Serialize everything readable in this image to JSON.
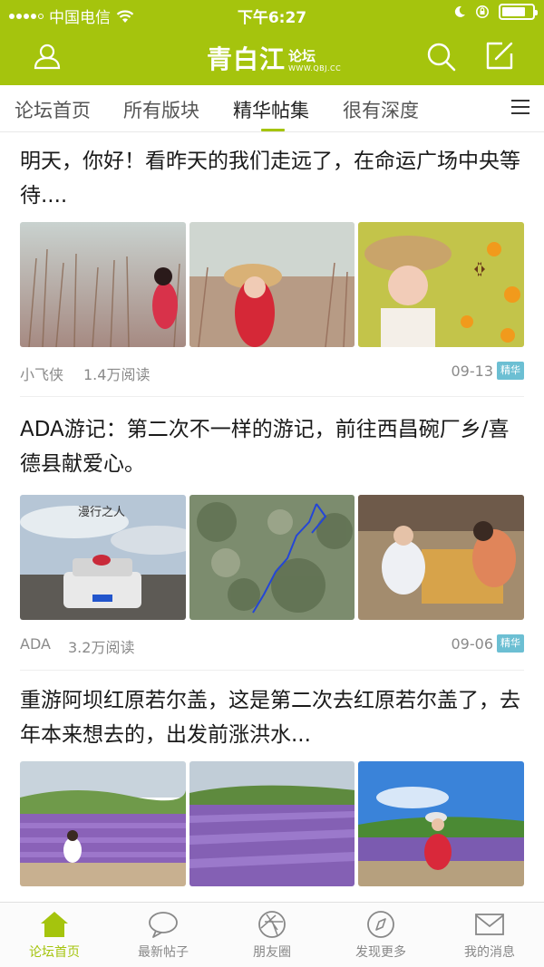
{
  "status_bar": {
    "carrier": "中国电信",
    "time": "下午6:27",
    "battery_level": 0.78
  },
  "header": {
    "logo_main": "青白江",
    "logo_sub": "论坛",
    "logo_url": "WWW.QBJ.CC",
    "icons": [
      "user-icon",
      "search-icon",
      "compose-icon"
    ]
  },
  "tabs": {
    "items": [
      {
        "label": "论坛首页"
      },
      {
        "label": "所有版块"
      },
      {
        "label": "精华帖集"
      },
      {
        "label": "很有深度"
      }
    ],
    "active_index": 2
  },
  "posts": [
    {
      "title": "明天，你好！看昨天的我们走远了，在命运广场中央等待....",
      "author": "小飞侠",
      "views": "1.4万阅读",
      "date": "09-13",
      "badge": "精华"
    },
    {
      "title": "ADA游记：第二次不一样的游记，前往西昌碗厂乡/喜德县献爱心。",
      "author": "ADA",
      "views": "3.2万阅读",
      "date": "09-06",
      "badge": "精华",
      "image_text": "漫行之人"
    },
    {
      "title": "重游阿坝红原若尔盖，这是第二次去红原若尔盖了，去年本来想去的，出发前涨洪水..."
    }
  ],
  "bottom_nav": {
    "items": [
      {
        "label": "论坛首页",
        "icon": "home-icon"
      },
      {
        "label": "最新帖子",
        "icon": "chat-bubble-icon"
      },
      {
        "label": "朋友圈",
        "icon": "camera-aperture-icon"
      },
      {
        "label": "发现更多",
        "icon": "compass-icon"
      },
      {
        "label": "我的消息",
        "icon": "mail-icon"
      }
    ],
    "active_index": 0
  },
  "colors": {
    "brand": "#a5c40d",
    "badge": "#6cbfd3"
  }
}
